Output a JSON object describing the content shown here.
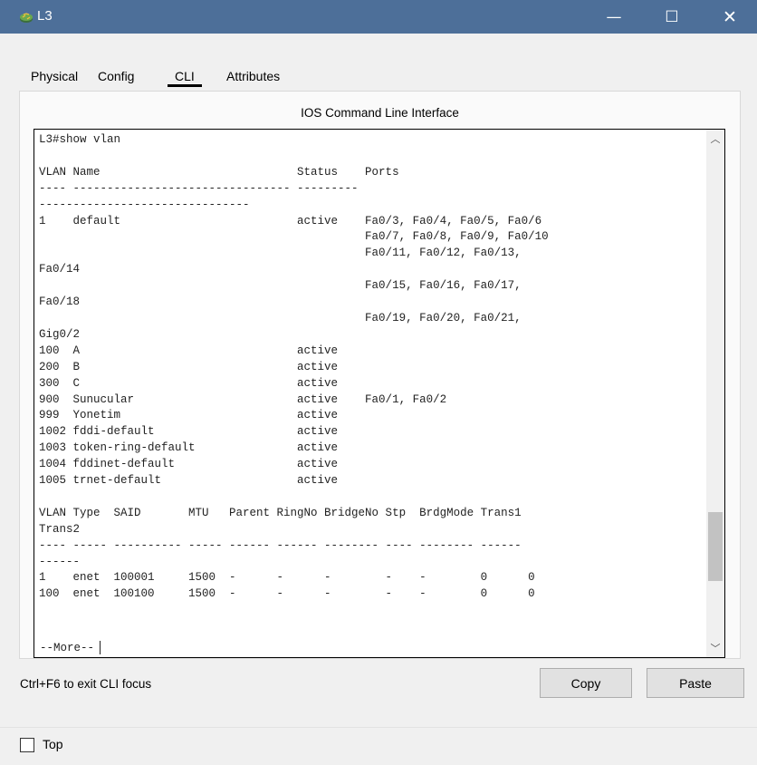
{
  "window": {
    "title": "L3",
    "minimize_glyph": "—",
    "maximize_glyph": "☐",
    "close_glyph": "✕",
    "icon": "router-icon"
  },
  "tabs": [
    {
      "label": "Physical",
      "active": false
    },
    {
      "label": "Config",
      "active": false
    },
    {
      "label": "CLI",
      "active": true
    },
    {
      "label": "Attributes",
      "active": false
    }
  ],
  "panel": {
    "title": "IOS Command Line Interface"
  },
  "cli": {
    "lines": [
      "L3#show vlan",
      "",
      "VLAN Name                             Status    Ports",
      "---- -------------------------------- ---------",
      "-------------------------------",
      "1    default                          active    Fa0/3, Fa0/4, Fa0/5, Fa0/6",
      "                                                Fa0/7, Fa0/8, Fa0/9, Fa0/10",
      "                                                Fa0/11, Fa0/12, Fa0/13,",
      "Fa0/14",
      "                                                Fa0/15, Fa0/16, Fa0/17,",
      "Fa0/18",
      "                                                Fa0/19, Fa0/20, Fa0/21,",
      "Gig0/2",
      "100  A                                active",
      "200  B                                active",
      "300  C                                active",
      "900  Sunucular                        active    Fa0/1, Fa0/2",
      "999  Yonetim                          active",
      "1002 fddi-default                     active",
      "1003 token-ring-default               active",
      "1004 fddinet-default                  active",
      "1005 trnet-default                    active",
      "",
      "VLAN Type  SAID       MTU   Parent RingNo BridgeNo Stp  BrdgMode Trans1",
      "Trans2",
      "---- ----- ---------- ----- ------ ------ -------- ---- -------- ------",
      "------",
      "1    enet  100001     1500  -      -      -        -    -        0      0",
      "100  enet  100100     1500  -      -      -        -    -        0      0"
    ],
    "more_prompt": " --More--",
    "scroll_position": 0.86,
    "scroll_thumb_fraction": 0.14
  },
  "footer": {
    "hint": "Ctrl+F6 to exit CLI focus",
    "copy_label": "Copy",
    "paste_label": "Paste",
    "top_label": "Top",
    "top_checked": false
  },
  "colors": {
    "titlebar": "#4d6f99",
    "background": "#f0f0f0"
  }
}
